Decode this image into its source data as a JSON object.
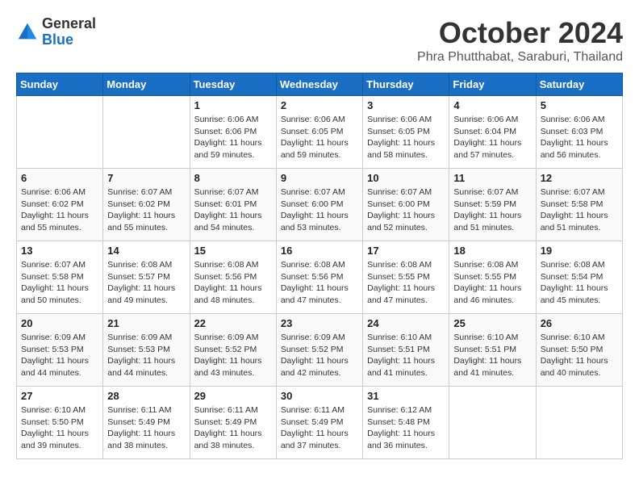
{
  "logo": {
    "general": "General",
    "blue": "Blue"
  },
  "title": "October 2024",
  "location": "Phra Phutthabat, Saraburi, Thailand",
  "days_of_week": [
    "Sunday",
    "Monday",
    "Tuesday",
    "Wednesday",
    "Thursday",
    "Friday",
    "Saturday"
  ],
  "weeks": [
    [
      {
        "day": "",
        "info": ""
      },
      {
        "day": "",
        "info": ""
      },
      {
        "day": "1",
        "sunrise": "6:06 AM",
        "sunset": "6:06 PM",
        "daylight": "11 hours and 59 minutes."
      },
      {
        "day": "2",
        "sunrise": "6:06 AM",
        "sunset": "6:05 PM",
        "daylight": "11 hours and 59 minutes."
      },
      {
        "day": "3",
        "sunrise": "6:06 AM",
        "sunset": "6:05 PM",
        "daylight": "11 hours and 58 minutes."
      },
      {
        "day": "4",
        "sunrise": "6:06 AM",
        "sunset": "6:04 PM",
        "daylight": "11 hours and 57 minutes."
      },
      {
        "day": "5",
        "sunrise": "6:06 AM",
        "sunset": "6:03 PM",
        "daylight": "11 hours and 56 minutes."
      }
    ],
    [
      {
        "day": "6",
        "sunrise": "6:06 AM",
        "sunset": "6:02 PM",
        "daylight": "11 hours and 55 minutes."
      },
      {
        "day": "7",
        "sunrise": "6:07 AM",
        "sunset": "6:02 PM",
        "daylight": "11 hours and 55 minutes."
      },
      {
        "day": "8",
        "sunrise": "6:07 AM",
        "sunset": "6:01 PM",
        "daylight": "11 hours and 54 minutes."
      },
      {
        "day": "9",
        "sunrise": "6:07 AM",
        "sunset": "6:00 PM",
        "daylight": "11 hours and 53 minutes."
      },
      {
        "day": "10",
        "sunrise": "6:07 AM",
        "sunset": "6:00 PM",
        "daylight": "11 hours and 52 minutes."
      },
      {
        "day": "11",
        "sunrise": "6:07 AM",
        "sunset": "5:59 PM",
        "daylight": "11 hours and 51 minutes."
      },
      {
        "day": "12",
        "sunrise": "6:07 AM",
        "sunset": "5:58 PM",
        "daylight": "11 hours and 51 minutes."
      }
    ],
    [
      {
        "day": "13",
        "sunrise": "6:07 AM",
        "sunset": "5:58 PM",
        "daylight": "11 hours and 50 minutes."
      },
      {
        "day": "14",
        "sunrise": "6:08 AM",
        "sunset": "5:57 PM",
        "daylight": "11 hours and 49 minutes."
      },
      {
        "day": "15",
        "sunrise": "6:08 AM",
        "sunset": "5:56 PM",
        "daylight": "11 hours and 48 minutes."
      },
      {
        "day": "16",
        "sunrise": "6:08 AM",
        "sunset": "5:56 PM",
        "daylight": "11 hours and 47 minutes."
      },
      {
        "day": "17",
        "sunrise": "6:08 AM",
        "sunset": "5:55 PM",
        "daylight": "11 hours and 47 minutes."
      },
      {
        "day": "18",
        "sunrise": "6:08 AM",
        "sunset": "5:55 PM",
        "daylight": "11 hours and 46 minutes."
      },
      {
        "day": "19",
        "sunrise": "6:08 AM",
        "sunset": "5:54 PM",
        "daylight": "11 hours and 45 minutes."
      }
    ],
    [
      {
        "day": "20",
        "sunrise": "6:09 AM",
        "sunset": "5:53 PM",
        "daylight": "11 hours and 44 minutes."
      },
      {
        "day": "21",
        "sunrise": "6:09 AM",
        "sunset": "5:53 PM",
        "daylight": "11 hours and 44 minutes."
      },
      {
        "day": "22",
        "sunrise": "6:09 AM",
        "sunset": "5:52 PM",
        "daylight": "11 hours and 43 minutes."
      },
      {
        "day": "23",
        "sunrise": "6:09 AM",
        "sunset": "5:52 PM",
        "daylight": "11 hours and 42 minutes."
      },
      {
        "day": "24",
        "sunrise": "6:10 AM",
        "sunset": "5:51 PM",
        "daylight": "11 hours and 41 minutes."
      },
      {
        "day": "25",
        "sunrise": "6:10 AM",
        "sunset": "5:51 PM",
        "daylight": "11 hours and 41 minutes."
      },
      {
        "day": "26",
        "sunrise": "6:10 AM",
        "sunset": "5:50 PM",
        "daylight": "11 hours and 40 minutes."
      }
    ],
    [
      {
        "day": "27",
        "sunrise": "6:10 AM",
        "sunset": "5:50 PM",
        "daylight": "11 hours and 39 minutes."
      },
      {
        "day": "28",
        "sunrise": "6:11 AM",
        "sunset": "5:49 PM",
        "daylight": "11 hours and 38 minutes."
      },
      {
        "day": "29",
        "sunrise": "6:11 AM",
        "sunset": "5:49 PM",
        "daylight": "11 hours and 38 minutes."
      },
      {
        "day": "30",
        "sunrise": "6:11 AM",
        "sunset": "5:49 PM",
        "daylight": "11 hours and 37 minutes."
      },
      {
        "day": "31",
        "sunrise": "6:12 AM",
        "sunset": "5:48 PM",
        "daylight": "11 hours and 36 minutes."
      },
      {
        "day": "",
        "info": ""
      },
      {
        "day": "",
        "info": ""
      }
    ]
  ],
  "labels": {
    "sunrise": "Sunrise:",
    "sunset": "Sunset:",
    "daylight": "Daylight:"
  }
}
